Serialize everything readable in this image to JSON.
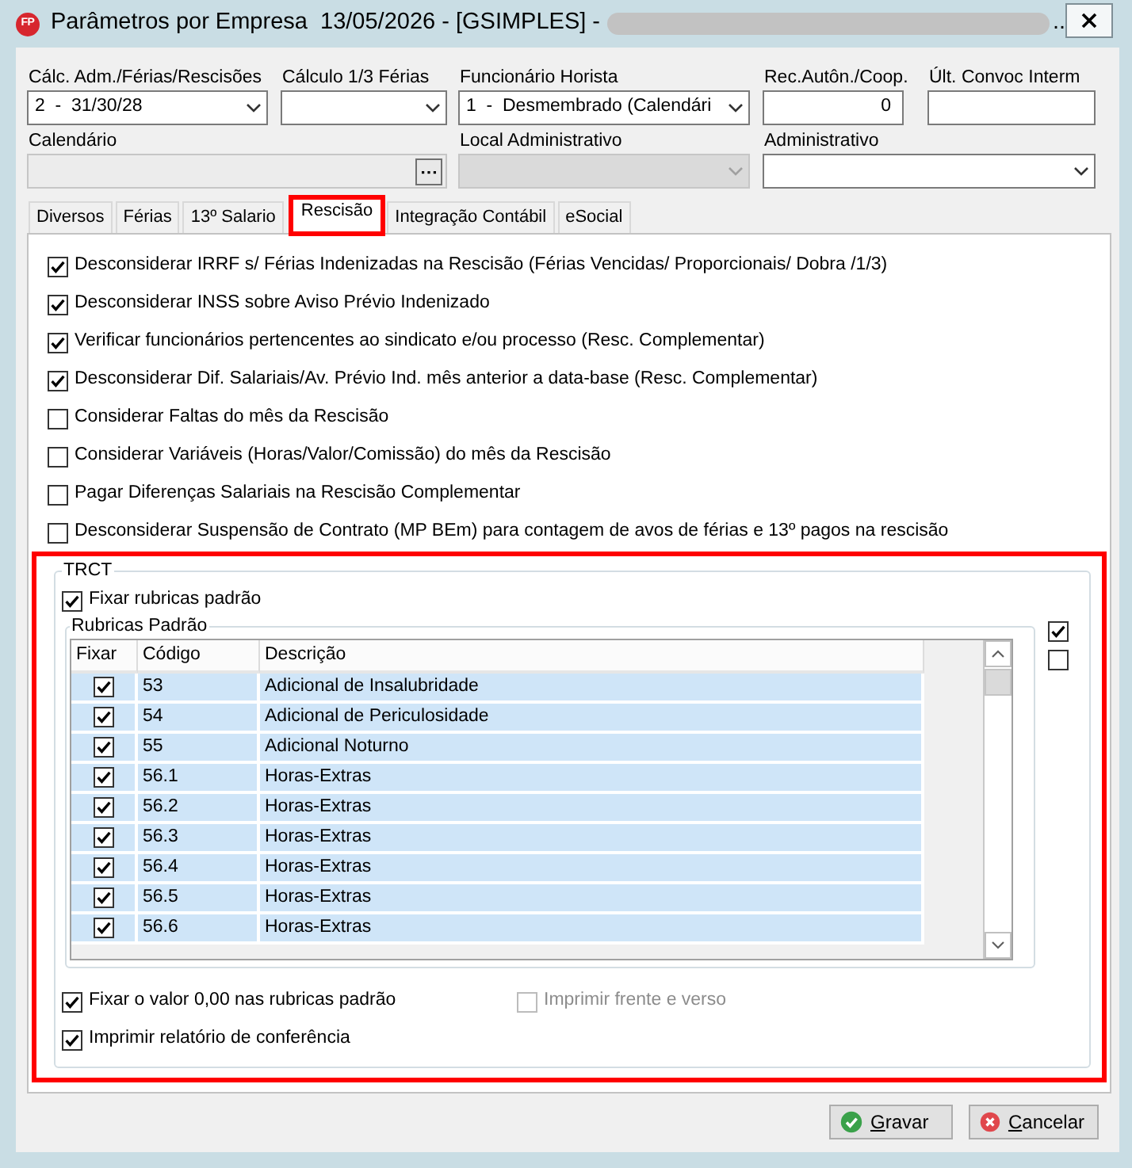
{
  "window": {
    "logo": "FP",
    "title": "Parâmetros por Empresa  13/05/2026 - [GSIMPLES] -",
    "title_redacted": true,
    "title_tail": ".."
  },
  "fields": [
    [
      {
        "kind": "select",
        "label": "Cálc. Adm./Férias/Rescisões",
        "value": "2  -  31/30/28",
        "disabled": false
      },
      {
        "kind": "select",
        "label": "Cálculo 1/3 Férias",
        "disabled": false
      },
      {
        "kind": "select",
        "label": "Funcionário Horista",
        "value": "1  -  Desmembrado (Calendári",
        "disabled": false
      },
      {
        "kind": "number",
        "label": "Rec.Autôn./Coop.",
        "value": "0",
        "disabled": false
      },
      {
        "kind": "text",
        "label": "Últ. Convoc Interm",
        "disabled": false
      }
    ],
    [
      {
        "kind": "browse",
        "label": "Calendário",
        "disabled": true
      },
      {
        "kind": "select",
        "label": "Local Administrativo",
        "disabled": true
      },
      {
        "kind": "select",
        "label": "Administrativo",
        "disabled": false
      }
    ]
  ],
  "tabs": [
    {
      "label": "Diversos",
      "selected": false,
      "highlighted": false
    },
    {
      "label": "Férias",
      "selected": false,
      "highlighted": false
    },
    {
      "label": "13º Salario",
      "selected": false,
      "highlighted": false
    },
    {
      "label": "Rescisão",
      "selected": true,
      "highlighted": true
    },
    {
      "label": "Integração Contábil",
      "selected": false,
      "highlighted": false
    },
    {
      "label": "eSocial",
      "selected": false,
      "highlighted": false
    }
  ],
  "options": [
    {
      "label": "Desconsiderar IRRF s/ Férias Indenizadas na Rescisão (Férias Vencidas/ Proporcionais/ Dobra /1/3)",
      "checked": true
    },
    {
      "label": "Desconsiderar INSS sobre Aviso Prévio Indenizado",
      "checked": true
    },
    {
      "label": "Verificar funcionários pertencentes ao sindicato e/ou processo (Resc. Complementar)",
      "checked": true
    },
    {
      "label": "Desconsiderar Dif. Salariais/Av. Prévio Ind. mês anterior a data-base (Resc. Complementar)",
      "checked": true
    },
    {
      "label": "Considerar Faltas do mês da Rescisão",
      "checked": false
    },
    {
      "label": "Considerar Variáveis (Horas/Valor/Comissão) do mês da Rescisão",
      "checked": false
    },
    {
      "label": "Pagar Diferenças Salariais na Rescisão Complementar",
      "checked": false
    },
    {
      "label": "Desconsiderar Suspensão de Contrato (MP BEm) para contagem de avos de férias e 13º pagos na rescisão",
      "checked": false
    }
  ],
  "trct": {
    "highlighted": true,
    "title": "TRCT",
    "fix_default": {
      "label": "Fixar rubricas padrão",
      "checked": true
    },
    "rubricas": {
      "title": "Rubricas Padrão",
      "columns": [
        "Fixar",
        "Código",
        "Descrição"
      ],
      "rows": [
        {
          "checked": true,
          "code": "53",
          "description": "Adicional de Insalubridade"
        },
        {
          "checked": true,
          "code": "54",
          "description": "Adicional de Periculosidade"
        },
        {
          "checked": true,
          "code": "55",
          "description": "Adicional Noturno"
        },
        {
          "checked": true,
          "code": "56.1",
          "description": "Horas-Extras"
        },
        {
          "checked": true,
          "code": "56.2",
          "description": "Horas-Extras"
        },
        {
          "checked": true,
          "code": "56.3",
          "description": "Horas-Extras"
        },
        {
          "checked": true,
          "code": "56.4",
          "description": "Horas-Extras"
        },
        {
          "checked": true,
          "code": "56.5",
          "description": "Horas-Extras"
        },
        {
          "checked": true,
          "code": "56.6",
          "description": "Horas-Extras"
        }
      ]
    },
    "side_checks": [
      {
        "checked": true
      },
      {
        "checked": false
      }
    ],
    "options": [
      {
        "label": "Fixar o valor 0,00 nas rubricas padrão",
        "checked": true,
        "disabled": false
      },
      {
        "label": "Imprimir frente e verso",
        "checked": false,
        "disabled": true
      },
      {
        "label": "Imprimir relatório de conferência",
        "checked": true,
        "disabled": false
      }
    ]
  },
  "buttons": [
    {
      "kind": "save",
      "label": "Gravar"
    },
    {
      "kind": "cancel",
      "label": "Cancelar"
    }
  ]
}
